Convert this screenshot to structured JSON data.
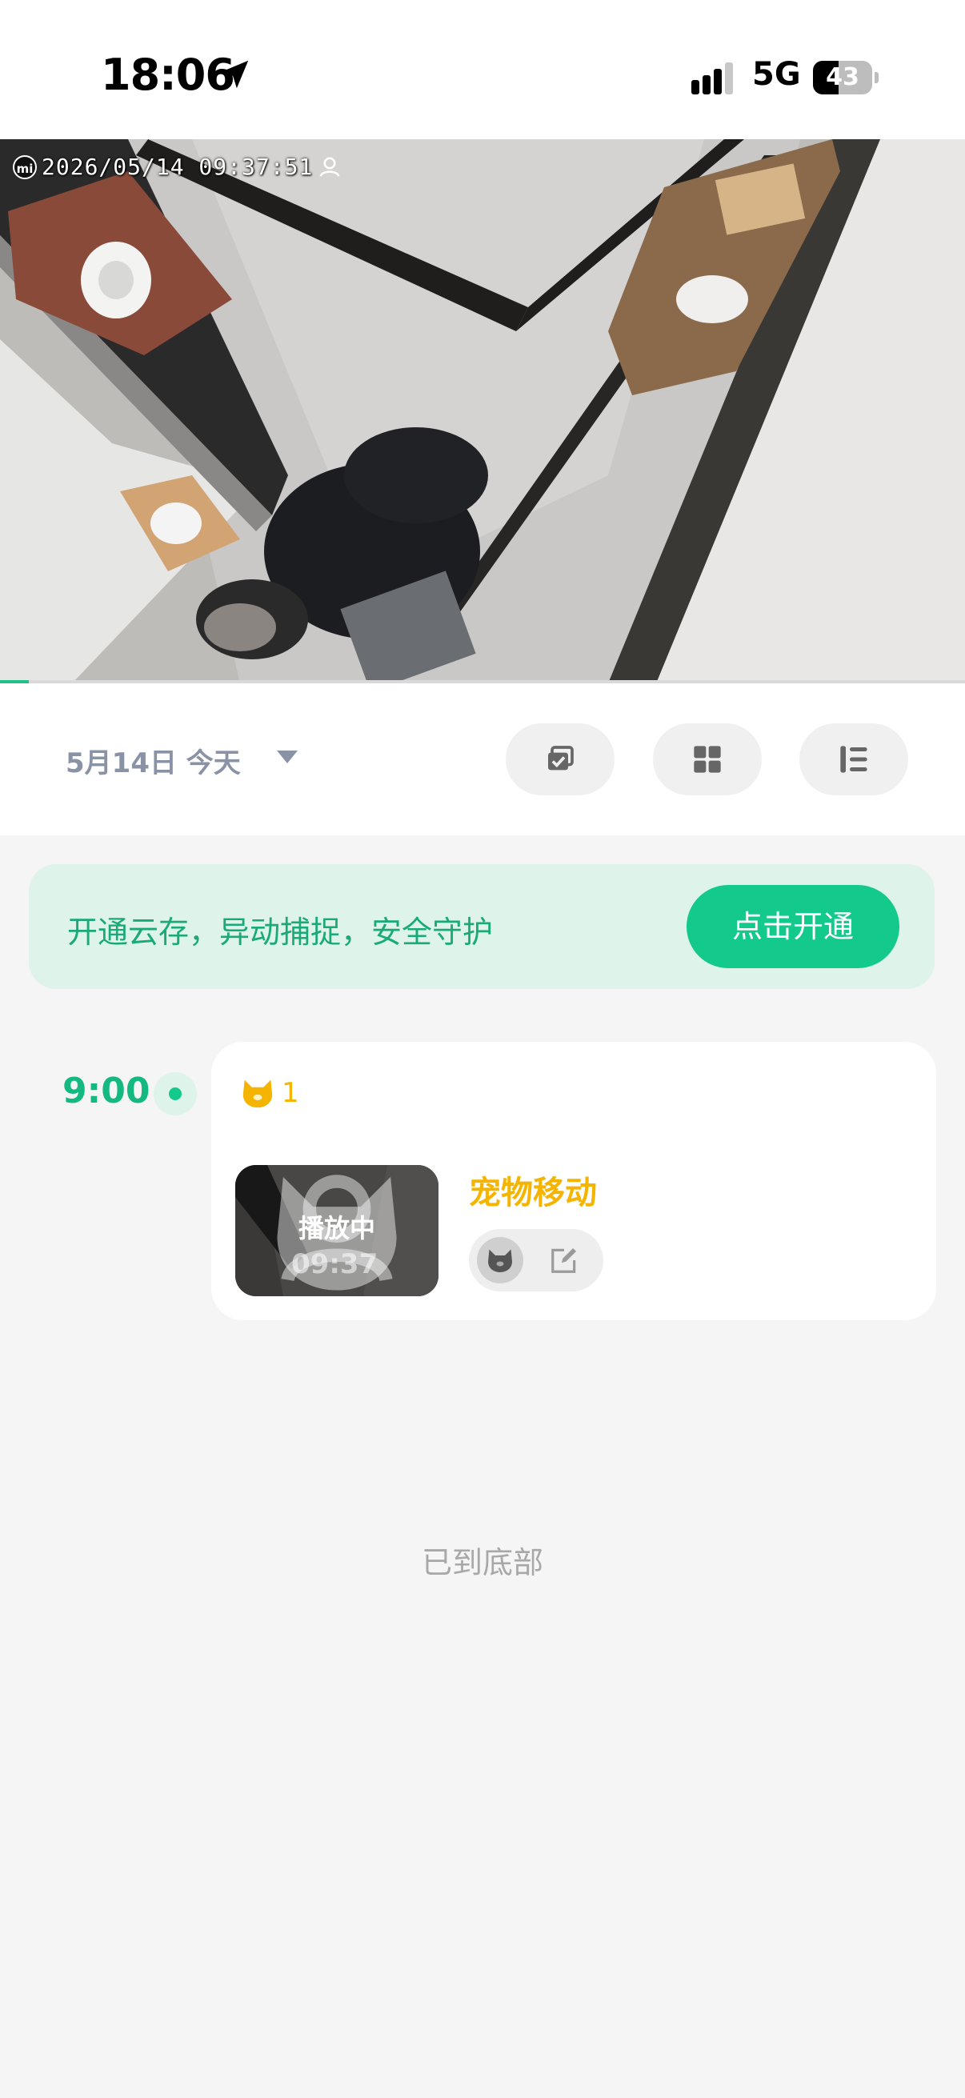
{
  "status_bar": {
    "time": "18:06",
    "network": "5G",
    "battery_percent": 43,
    "battery_label": "43",
    "icons": [
      "location-arrow-icon",
      "cellular-signal-icon",
      "battery-icon"
    ]
  },
  "camera": {
    "timestamp": "2026/05/14 09:37:51",
    "brand_mark": "mi",
    "playback_progress": 0.03
  },
  "toolbar": {
    "date_label": "5月14日  今天",
    "buttons": [
      "multi-select-icon",
      "grid-view-icon",
      "list-view-icon"
    ]
  },
  "banner": {
    "text": "开通云存，异动捕捉，安全守护",
    "button_label": "点击开通"
  },
  "timeline": {
    "hour_label": "9:00",
    "events": [
      {
        "type_icon": "cat-icon",
        "count": "1",
        "thumbnail_status": "播放中",
        "thumbnail_time": "09:37",
        "title": "宠物移动"
      }
    ]
  },
  "footer": {
    "end_text": "已到底部"
  },
  "colors": {
    "accent_green": "#14c98c",
    "pet_yellow": "#f4b400",
    "banner_bg": "#def3ea"
  }
}
